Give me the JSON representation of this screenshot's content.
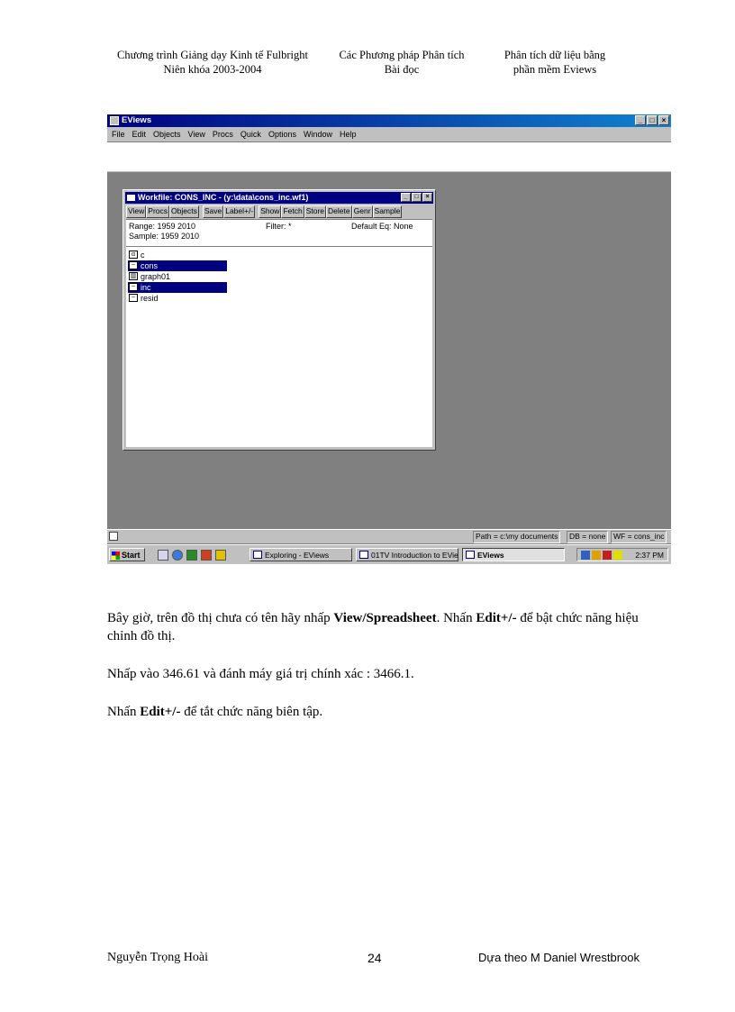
{
  "header": {
    "col1": [
      "Chương trình Giảng dạy Kinh tế Fulbright",
      "Niên khóa 2003-2004"
    ],
    "col2": [
      "Các Phương pháp Phân tích",
      "Bài đọc"
    ],
    "col3": [
      "Phân tích dữ liệu  bằng",
      "phần mềm Eviews"
    ]
  },
  "app": {
    "title": "EViews",
    "window_controls": [
      "_",
      "□",
      "×"
    ],
    "menu": [
      "File",
      "Edit",
      "Objects",
      "View",
      "Procs",
      "Quick",
      "Options",
      "Window",
      "Help"
    ]
  },
  "workfile": {
    "title": "Workfile: CONS_INC - (y:\\data\\cons_inc.wf1)",
    "toolbar": [
      "View",
      "Procs",
      "Objects",
      "Save",
      "Label+/-",
      "Show",
      "Fetch",
      "Store",
      "Delete",
      "Genr",
      "Sample"
    ],
    "range": "Range:  1959 2010",
    "sample": "Sample: 1959 2010",
    "filter": "Filter: *",
    "default_eq": "Default Eq: None",
    "objects": [
      {
        "name": "c",
        "icon": "alpha-icon",
        "selected": false
      },
      {
        "name": "cons",
        "icon": "series-icon",
        "selected": true
      },
      {
        "name": "graph01",
        "icon": "graph-icon",
        "selected": false
      },
      {
        "name": "inc",
        "icon": "series-icon",
        "selected": true
      },
      {
        "name": "resid",
        "icon": "series-icon",
        "selected": false
      }
    ]
  },
  "status": {
    "path": "Path = c:\\my documents",
    "db": "DB = none",
    "wf": "WF = cons_inc"
  },
  "taskbar": {
    "start": "Start",
    "tasks": [
      "Exploring - EViews",
      "01TV Introduction to EVie...",
      "EViews"
    ],
    "clock": "2:37 PM"
  },
  "body": {
    "p1_a": "Bây giờ, trên đồ thị chưa có tên hãy nhấp ",
    "p1_b": "View/Spreadsheet",
    "p1_c": ".  Nhấn ",
    "p1_d": "Edit+/-",
    "p1_e": " để bật chức năng hiệu chỉnh đồ thị.",
    "p2": "Nhấp vào 346.61 và đánh máy giá trị chính xác : 3466.1.",
    "p3_a": "Nhấn ",
    "p3_b": "Edit+/-",
    "p3_c": " để tắt chức năng biên tập."
  },
  "footer": {
    "author": "Nguyễn Trọng Hoài",
    "page": "24",
    "credit": "Dựa theo M Daniel Wrestbrook"
  },
  "colors": {
    "titlebar": "#000080",
    "desktop": "#808080",
    "chrome": "#c0c0c0"
  }
}
